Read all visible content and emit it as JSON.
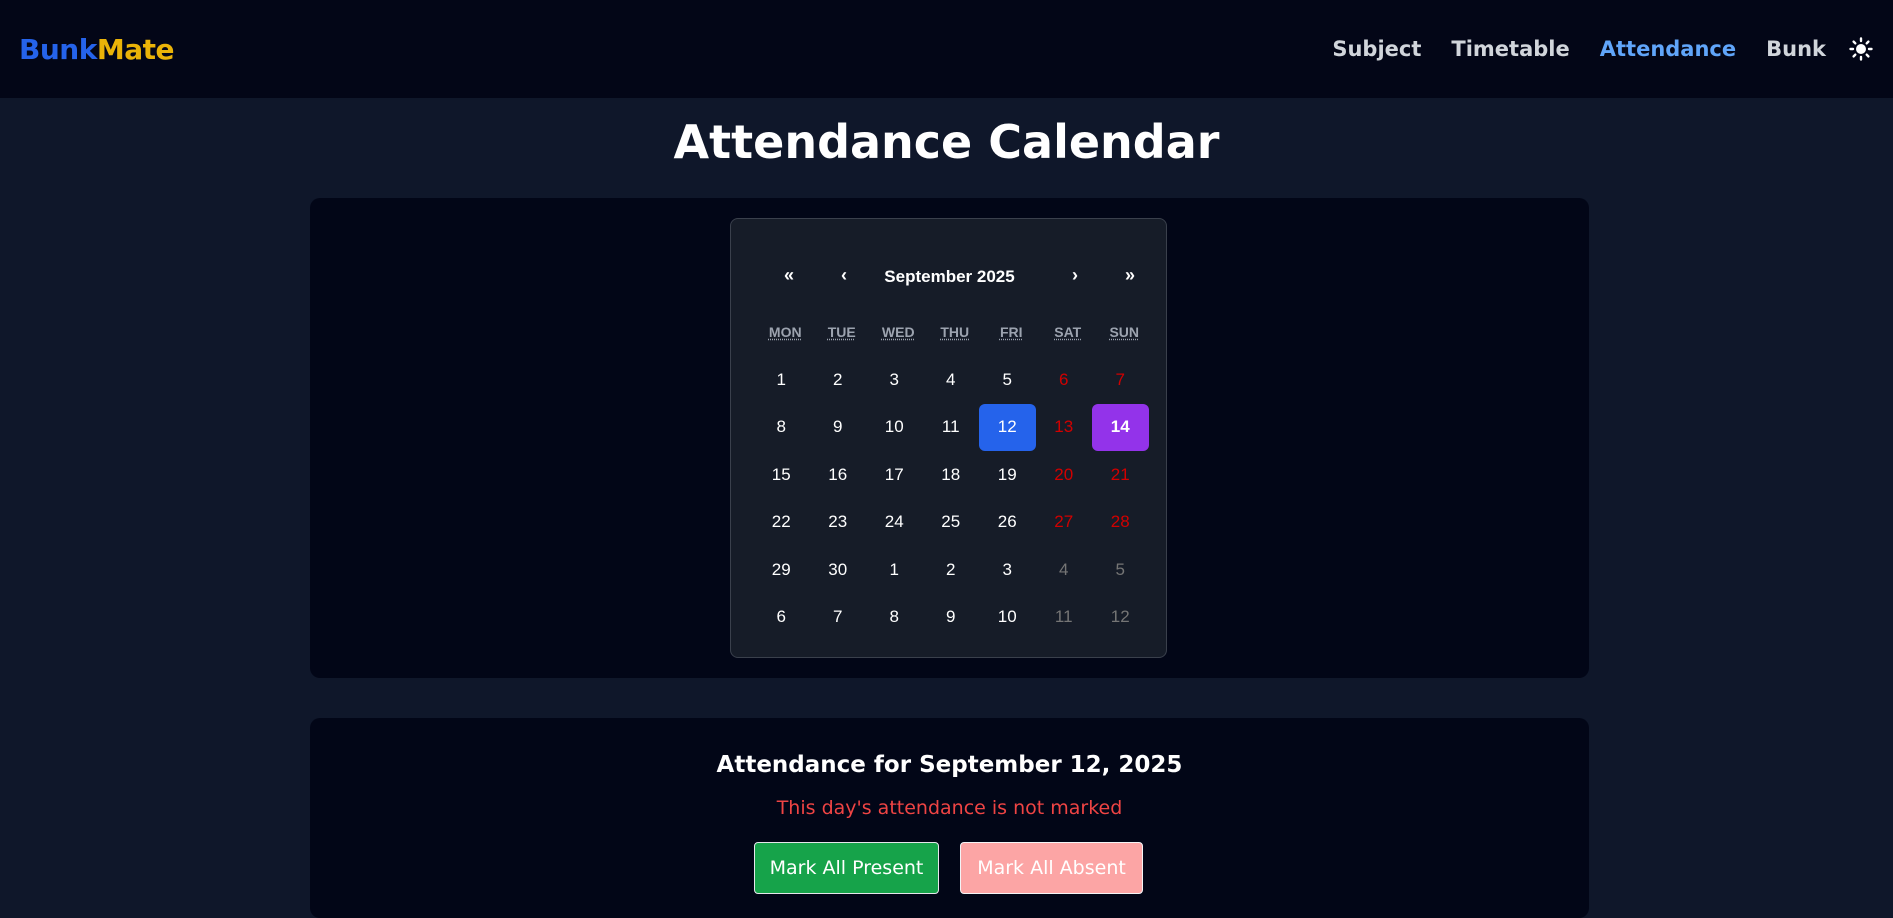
{
  "brand": {
    "part1": "Bunk",
    "part2": "Mate"
  },
  "nav": {
    "items": [
      {
        "label": "Subject"
      },
      {
        "label": "Timetable"
      },
      {
        "label": "Attendance"
      },
      {
        "label": "Bunk"
      }
    ],
    "theme_icon": "sun-icon"
  },
  "page": {
    "title": "Attendance Calendar"
  },
  "calendar": {
    "prev_year": "«",
    "prev_month": "‹",
    "month_label": "September 2025",
    "next_month": "›",
    "next_year": "»",
    "weekdays": [
      "MON",
      "TUE",
      "WED",
      "THU",
      "FRI",
      "SAT",
      "SUN"
    ],
    "weeks": [
      [
        "1",
        "2",
        "3",
        "4",
        "5",
        "6",
        "7"
      ],
      [
        "8",
        "9",
        "10",
        "11",
        "12",
        "13",
        "14"
      ],
      [
        "15",
        "16",
        "17",
        "18",
        "19",
        "20",
        "21"
      ],
      [
        "22",
        "23",
        "24",
        "25",
        "26",
        "27",
        "28"
      ],
      [
        "29",
        "30",
        "1",
        "2",
        "3",
        "4",
        "5"
      ],
      [
        "6",
        "7",
        "8",
        "9",
        "10",
        "11",
        "12"
      ]
    ]
  },
  "attendance": {
    "title": "Attendance for September 12, 2025",
    "status": "This day's attendance is not marked",
    "mark_present": "Mark All Present",
    "mark_absent": "Mark All Absent"
  }
}
